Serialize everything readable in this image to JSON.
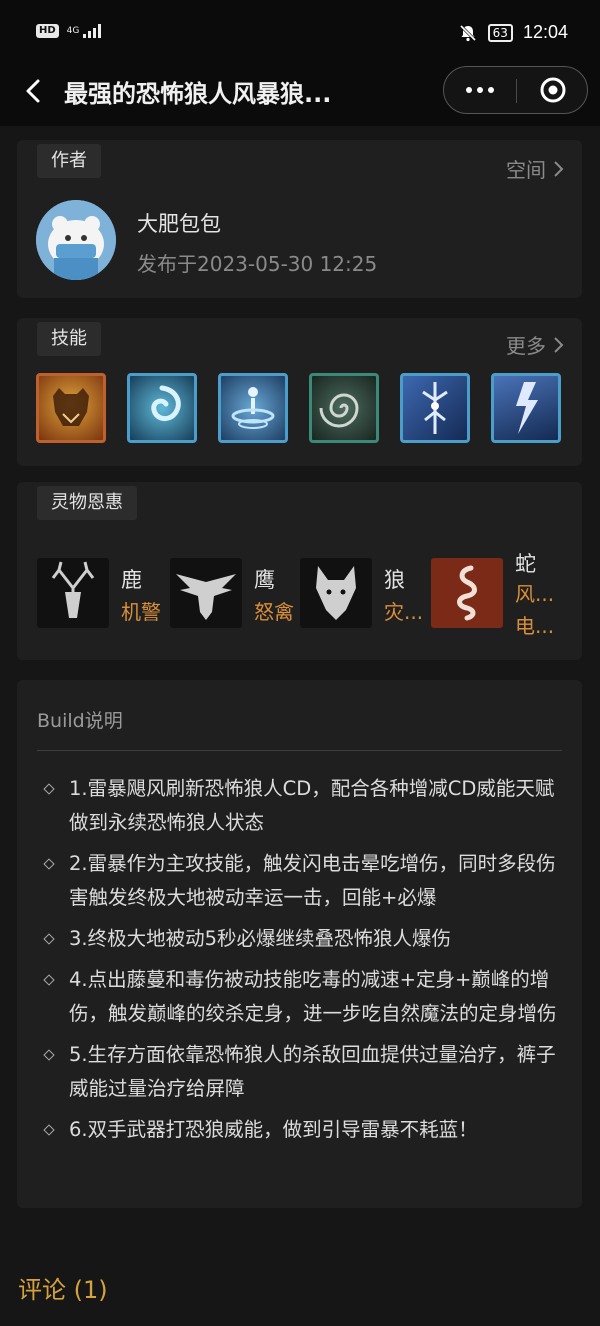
{
  "status_bar": {
    "hd": "HD",
    "network": "4G",
    "battery": "63",
    "time": "12:04"
  },
  "nav": {
    "title": "最强的恐怖狼人风暴狼...",
    "back_icon": "chevron-left-icon",
    "more_icon": "ellipsis-icon",
    "close_icon": "target-icon"
  },
  "author_card": {
    "tag": "作者",
    "space_link": "空间",
    "name": "大肥包包",
    "published": "发布于2023-05-30 12:25"
  },
  "skills_card": {
    "tag": "技能",
    "more_link": "更多",
    "skills": [
      {
        "icon": "bear-roar-skill-icon",
        "border": "#b5522a",
        "bg": "#a8591c"
      },
      {
        "icon": "vortex-skill-icon",
        "border": "#4b9ec9",
        "bg": "#1f5978"
      },
      {
        "icon": "cyclone-skill-icon",
        "border": "#4b9ec9",
        "bg": "#2d5f86"
      },
      {
        "icon": "spiral-skill-icon",
        "border": "#3b8a78",
        "bg": "#1f3e37"
      },
      {
        "icon": "lightning-strike-skill-icon",
        "border": "#4b9ec9",
        "bg": "#2b4f8a"
      },
      {
        "icon": "storm-bolt-skill-icon",
        "border": "#4b9ec9",
        "bg": "#2a4c7e"
      }
    ]
  },
  "boons_card": {
    "tag": "灵物恩惠",
    "boons": [
      {
        "name": "鹿",
        "sub": "机警",
        "icon": "deer-skull-icon"
      },
      {
        "name": "鹰",
        "sub": "怒禽",
        "icon": "eagle-icon"
      },
      {
        "name": "狼",
        "sub": "灾...",
        "icon": "wolf-head-icon"
      },
      {
        "name": "蛇",
        "sub": "风...",
        "sub2": "电...",
        "icon": "snake-icon"
      }
    ]
  },
  "build_card": {
    "title": "Build说明",
    "items": [
      "1.雷暴飓风刷新恐怖狼人CD，配合各种增减CD威能天赋做到永续恐怖狼人状态",
      "2.雷暴作为主攻技能，触发闪电击晕吃增伤，同时多段伤害触发终极大地被动幸运一击，回能+必爆",
      "3.终极大地被动5秒必爆继续叠恐怖狼人爆伤",
      "4.点出藤蔓和毒伤被动技能吃毒的减速+定身+巅峰的增伤，触发巅峰的绞杀定身，进一步吃自然魔法的定身增伤",
      "5.生存方面依靠恐怖狼人的杀敌回血提供过量治疗，裤子威能过量治疗给屏障",
      "6.双手武器打恐狼威能，做到引导雷暴不耗蓝！"
    ]
  },
  "comments": {
    "label": "评论 (1)"
  }
}
